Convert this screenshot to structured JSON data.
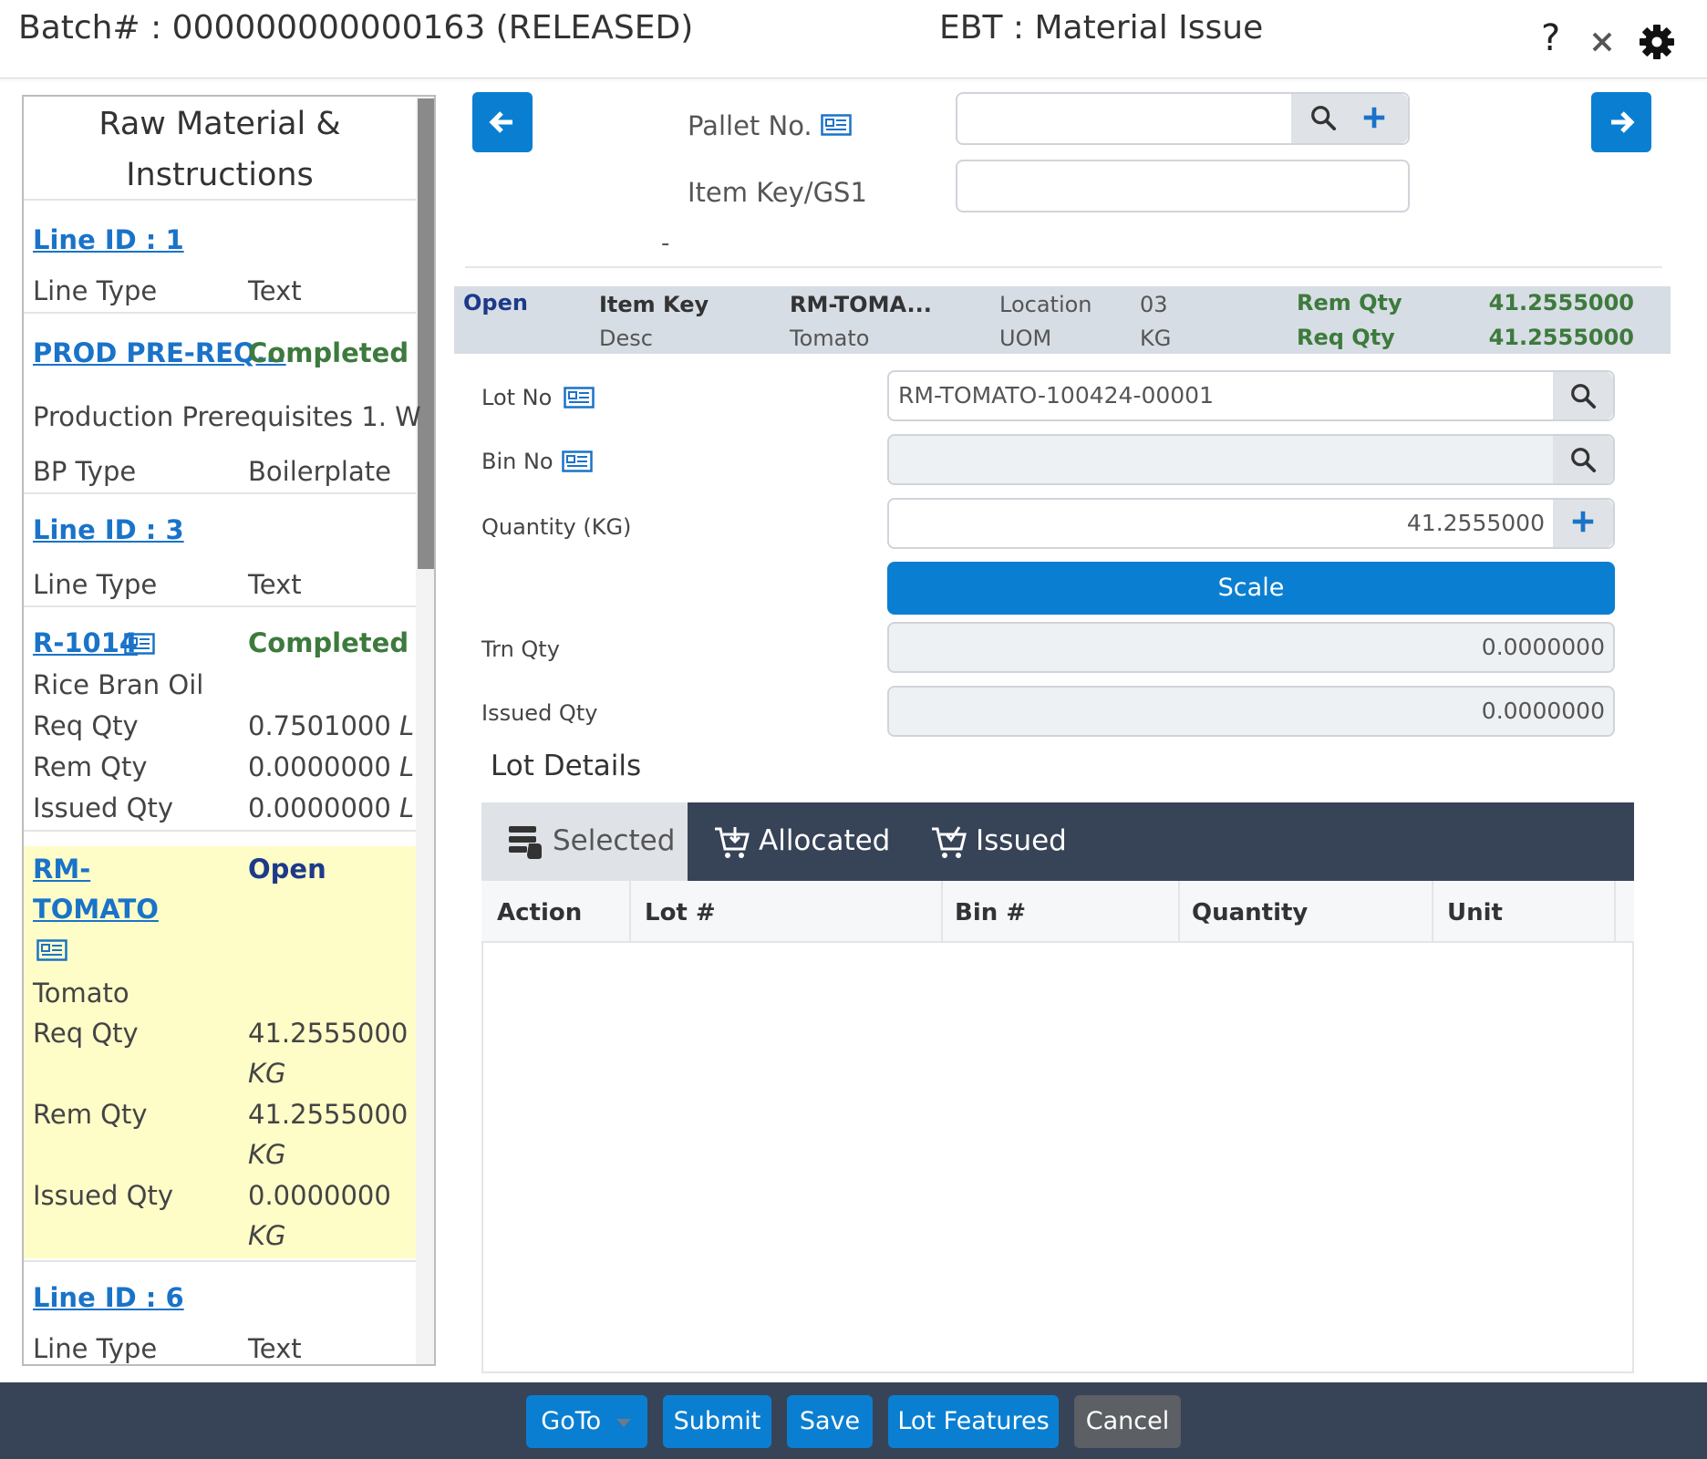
{
  "header": {
    "batch_title": "Batch# : 000000000000163 (RELEASED)",
    "screen_title": "EBT : Material Issue",
    "help_glyph": "?"
  },
  "left_panel": {
    "title": "Raw Material & Instructions",
    "items": [
      {
        "link": "Line ID : 1",
        "rows": [
          {
            "label": "Line Type",
            "value": "Text"
          }
        ]
      },
      {
        "link": "PROD PRE-REQ...",
        "status": "Completed",
        "description": "Production Prerequisites 1. W",
        "rows": [
          {
            "label": "BP Type",
            "value": "Boilerplate"
          }
        ]
      },
      {
        "link": "Line ID : 3",
        "rows": [
          {
            "label": "Line Type",
            "value": "Text"
          }
        ]
      },
      {
        "link": "R-1014",
        "status": "Completed",
        "description": "Rice Bran Oil",
        "rows": [
          {
            "label": "Req Qty",
            "value": "0.7501000",
            "unit": "L"
          },
          {
            "label": "Rem Qty",
            "value": "0.0000000",
            "unit": "L"
          },
          {
            "label": "Issued Qty",
            "value": "0.0000000",
            "unit": "L"
          }
        ]
      },
      {
        "link_line1": "RM-",
        "link_line2": "TOMATO",
        "status": "Open",
        "description": "Tomato",
        "rows": [
          {
            "label": "Req Qty",
            "value": "41.2555000",
            "unit": "KG"
          },
          {
            "label": "Rem Qty",
            "value": "41.2555000",
            "unit": "KG"
          },
          {
            "label": "Issued Qty",
            "value": "0.0000000",
            "unit": "KG"
          }
        ]
      },
      {
        "link": "Line ID : 6",
        "rows": [
          {
            "label": "Line Type",
            "value": "Text"
          }
        ]
      }
    ]
  },
  "form": {
    "pallet_label": "Pallet No.",
    "pallet_value": "",
    "itemkey_label": "Item Key/GS1",
    "itemkey_value": "",
    "dash": "-"
  },
  "summary": {
    "status": "Open",
    "item_key_label": "Item Key",
    "item_key_value": "RM-TOMA...",
    "desc_label": "Desc",
    "desc_value": "Tomato",
    "location_label": "Location",
    "location_value": "03",
    "uom_label": "UOM",
    "uom_value": "KG",
    "rem_qty_label": "Rem Qty",
    "rem_qty_value": "41.2555000",
    "req_qty_label": "Req Qty",
    "req_qty_value": "41.2555000"
  },
  "detail": {
    "lot_no_label": "Lot No",
    "lot_no_value": "RM-TOMATO-100424-00001",
    "bin_no_label": "Bin No",
    "bin_no_value": "",
    "quantity_label": "Quantity (KG)",
    "quantity_value": "41.2555000",
    "scale_label": "Scale",
    "trn_qty_label": "Trn Qty",
    "trn_qty_value": "0.0000000",
    "issued_qty_label": "Issued Qty",
    "issued_qty_value": "0.0000000"
  },
  "lot_details": {
    "title": "Lot Details",
    "tabs": [
      {
        "label": "Selected",
        "icon": "list-hand-icon",
        "active": true
      },
      {
        "label": "Allocated",
        "icon": "cart-icon",
        "active": false
      },
      {
        "label": "Issued",
        "icon": "cart-check-icon",
        "active": false
      }
    ],
    "columns": [
      "Action",
      "Lot #",
      "Bin #",
      "Quantity",
      "Unit"
    ],
    "rows": []
  },
  "footer": {
    "goto": "GoTo",
    "submit": "Submit",
    "save": "Save",
    "lot_features": "Lot Features",
    "cancel": "Cancel"
  },
  "colors": {
    "primary": "#0a7fd2",
    "dark_bar": "#374357",
    "completed": "#3d7a3d",
    "open": "#1d3a8a",
    "highlight": "#fefdc8",
    "link": "#1a73c8"
  }
}
